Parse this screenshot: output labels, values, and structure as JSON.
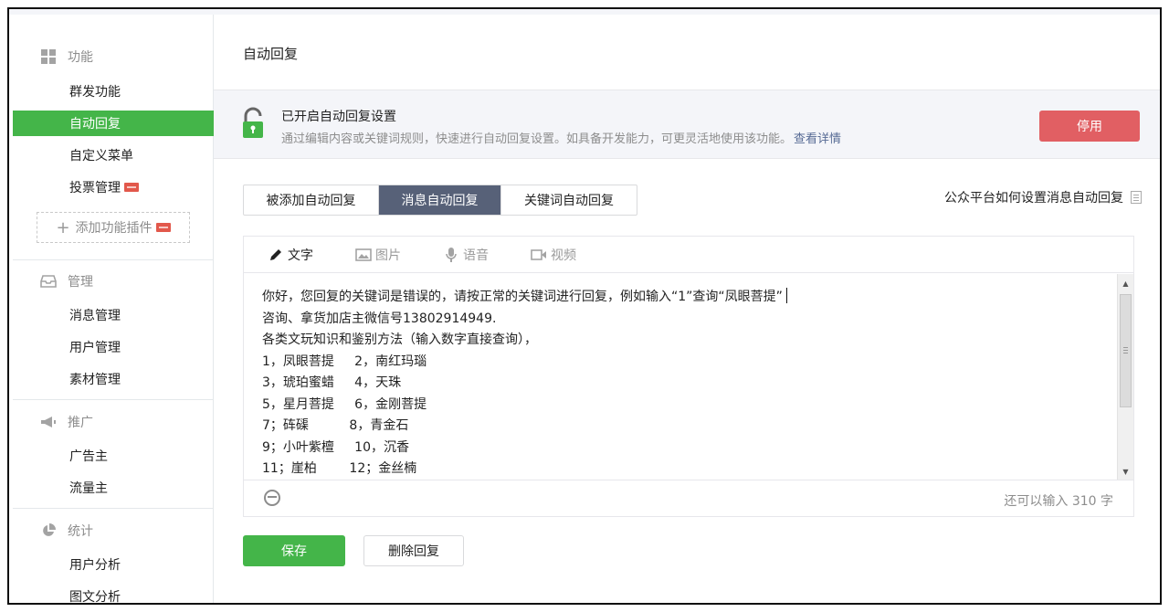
{
  "sidebar": {
    "groups": [
      {
        "title": "功能",
        "icon": "grid-icon",
        "items": [
          {
            "label": "群发功能",
            "active": false,
            "badge": false
          },
          {
            "label": "自动回复",
            "active": true,
            "badge": false
          },
          {
            "label": "自定义菜单",
            "active": false,
            "badge": false
          },
          {
            "label": "投票管理",
            "active": false,
            "badge": true
          }
        ]
      },
      {
        "title": "管理",
        "icon": "inbox-icon",
        "items": [
          {
            "label": "消息管理"
          },
          {
            "label": "用户管理"
          },
          {
            "label": "素材管理"
          }
        ]
      },
      {
        "title": "推广",
        "icon": "megaphone-icon",
        "items": [
          {
            "label": "广告主"
          },
          {
            "label": "流量主"
          }
        ]
      },
      {
        "title": "统计",
        "icon": "pie-chart-icon",
        "items": [
          {
            "label": "用户分析"
          },
          {
            "label": "图文分析"
          }
        ]
      }
    ],
    "add_plugin": "添加功能插件"
  },
  "main": {
    "title": "自动回复",
    "notice": {
      "title": "已开启自动回复设置",
      "desc": "通过编辑内容或关键词规则，快速进行自动回复设置。如具备开发能力，可更灵活地使用该功能。",
      "link": "查看详情",
      "stop_button": "停用"
    },
    "tabs": [
      {
        "label": "被添加自动回复",
        "active": false
      },
      {
        "label": "消息自动回复",
        "active": true
      },
      {
        "label": "关键词自动回复",
        "active": false
      }
    ],
    "help_link": "公众平台如何设置消息自动回复",
    "editor": {
      "tools": [
        {
          "label": "文字",
          "icon": "pencil-icon",
          "active": true
        },
        {
          "label": "图片",
          "icon": "image-icon",
          "active": false
        },
        {
          "label": "语音",
          "icon": "microphone-icon",
          "active": false
        },
        {
          "label": "视频",
          "icon": "video-icon",
          "active": false
        }
      ],
      "lines": [
        "你好，您回复的关键词是错误的，请按正常的关键词进行回复，例如输入“1”查询“凤眼菩提”",
        "咨询、拿货加店主微信号13802914949.",
        "各类文玩知识和鉴别方法（输入数字直接查询），",
        "1，凤眼菩提     2，南红玛瑙",
        "3，琥珀蜜蜡     4，天珠",
        "5，星月菩提     6，金刚菩提",
        "7；砗磲          8，青金石",
        "9；小叶紫檀     10，沉香",
        "11；崖柏        12；金丝楠"
      ],
      "char_count": "还可以输入 310 字"
    },
    "save_button": "保存",
    "delete_button": "删除回复"
  },
  "colors": {
    "brand_green": "#44b549",
    "danger_red": "#e15f63",
    "tab_active": "#576178",
    "link_blue": "#576b95"
  }
}
